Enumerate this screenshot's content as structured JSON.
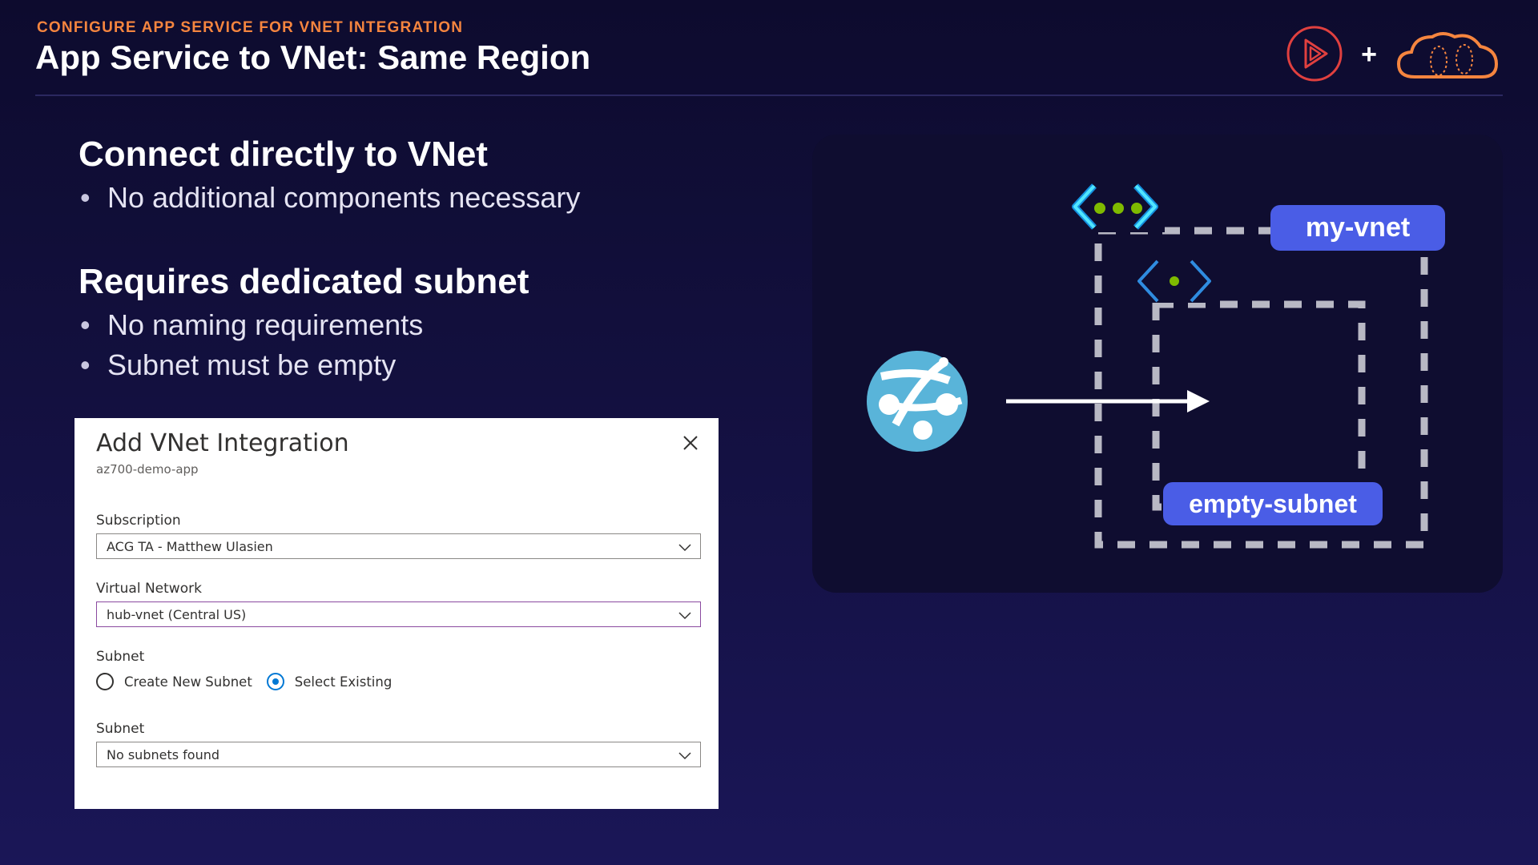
{
  "header": {
    "eyebrow": "CONFIGURE APP SERVICE FOR VNET INTEGRATION",
    "title": "App Service to VNet: Same Region"
  },
  "logos": {
    "plus": "+",
    "icons": [
      "play-logo-icon",
      "cloud-logo-icon"
    ]
  },
  "sections": [
    {
      "heading": "Connect directly to VNet",
      "bullets": [
        "No additional components necessary"
      ]
    },
    {
      "heading": "Requires dedicated subnet",
      "bullets": [
        "No naming requirements",
        "Subnet must be empty"
      ]
    }
  ],
  "bullet_glyph": "•",
  "dialog": {
    "title": "Add VNet Integration",
    "subtitle": "az700-demo-app",
    "subscription_label": "Subscription",
    "subscription_value": "ACG TA - Matthew Ulasien",
    "vnet_label": "Virtual Network",
    "vnet_value": "hub-vnet (Central US)",
    "subnet_mode_label": "Subnet",
    "subnet_options": [
      "Create New Subnet",
      "Select Existing"
    ],
    "subnet_selected": "Select Existing",
    "subnet_label": "Subnet",
    "subnet_value": "No subnets found"
  },
  "diagram": {
    "vnet_label": "my-vnet",
    "subnet_label": "empty-subnet"
  },
  "colors": {
    "accent_orange": "#f5853f",
    "pill_blue": "#4a5de6",
    "app_service_blue": "#59b4d9",
    "vnet_cyan": "#50e6ff",
    "dot_green": "#7fba00",
    "dashed_gray": "#b8b8c4"
  }
}
